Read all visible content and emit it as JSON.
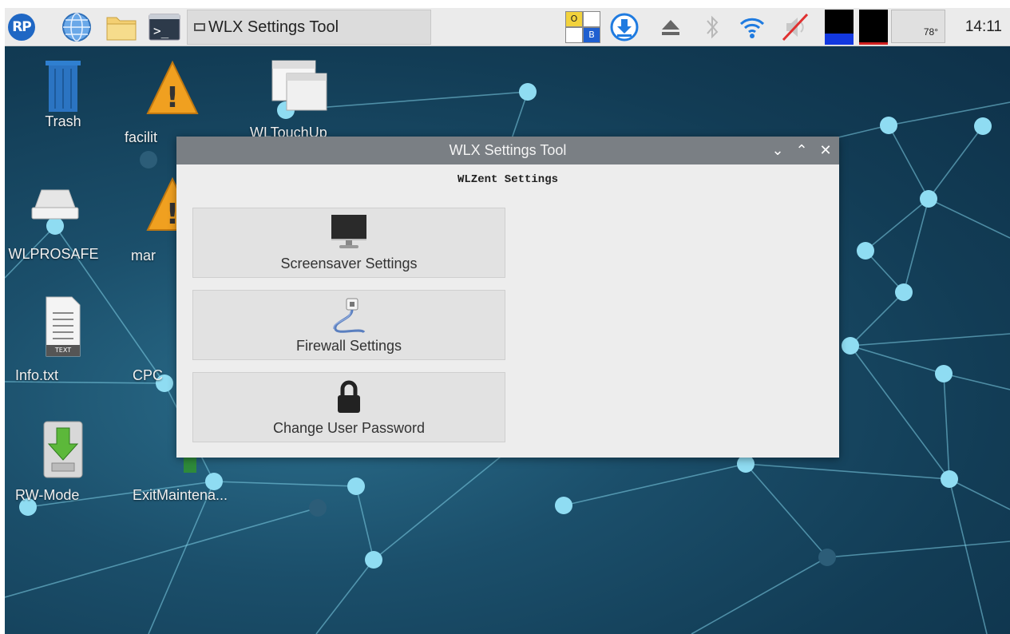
{
  "taskbar": {
    "logo_text": "RP",
    "task_title": "WLX Settings Tool",
    "keyboard_indicators": [
      "O",
      "B"
    ],
    "temperature": "78°",
    "clock": "14:11"
  },
  "desktop": {
    "icons": [
      {
        "label": "Trash"
      },
      {
        "label": "facilit"
      },
      {
        "label": "WLTouchUp"
      },
      {
        "label": "WLPROSAFE"
      },
      {
        "label": "mar"
      },
      {
        "label": "Info.txt"
      },
      {
        "label": "CPC"
      },
      {
        "label": "RW-Mode"
      },
      {
        "label": "ExitMaintena..."
      }
    ],
    "info_badge": "TEXT"
  },
  "window": {
    "title": "WLX Settings Tool",
    "heading": "WLZent Settings",
    "buttons": [
      {
        "label": "Screensaver Settings",
        "icon": "monitor-icon"
      },
      {
        "label": "Firewall Settings",
        "icon": "network-cable-icon"
      },
      {
        "label": "Change User Password",
        "icon": "lock-icon"
      }
    ]
  },
  "colors": {
    "taskbar_bg": "#ebebeb",
    "titlebar_bg": "#7a7f84",
    "window_bg": "#ededed",
    "desktop_accent": "#8fdcf2"
  }
}
